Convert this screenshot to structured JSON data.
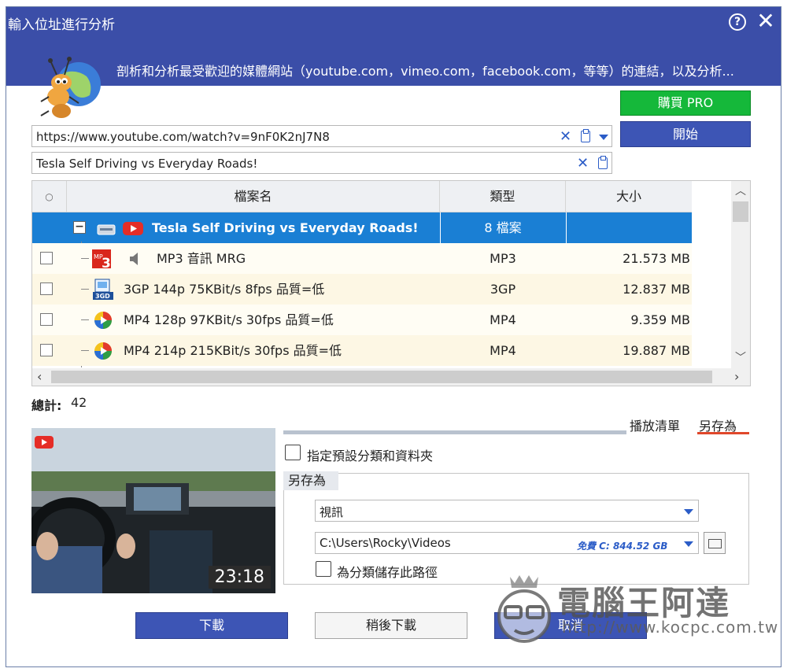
{
  "window": {
    "title": "輸入位址進行分析",
    "help_glyph": "?",
    "close_glyph": "✕",
    "description": "剖析和分析最受歡迎的媒體網站（youtube.com，vimeo.com，facebook.com，等等）的連結，以及分析..."
  },
  "buttons": {
    "buy_label": "購買 PRO",
    "start_label": "開始",
    "download_label": "下載",
    "download_later_label": "稍後下載",
    "cancel_label": "取消"
  },
  "url_field": {
    "value": "https://www.youtube.com/watch?v=9nF0K2nJ7N8"
  },
  "title_field": {
    "value": "Tesla Self Driving vs Everyday Roads!"
  },
  "table": {
    "columns": [
      "○",
      "檔案名",
      "類型",
      "大小"
    ],
    "parent": {
      "name": "Tesla Self Driving vs Everyday Roads!",
      "type": "8 檔案",
      "size": ""
    },
    "rows": [
      {
        "name": "MP3 音訊 MRG",
        "type": "MP3",
        "size": "21.573 MB"
      },
      {
        "name": "3GP 144p 75KBit/s 8fps 品質=低",
        "type": "3GP",
        "size": "12.837 MB"
      },
      {
        "name": "MP4 128p 97KBit/s 30fps 品質=低",
        "type": "MP4",
        "size": "9.359 MB"
      },
      {
        "name": "MP4 214p 215KBit/s 30fps 品質=低",
        "type": "MP4",
        "size": "19.887 MB"
      }
    ]
  },
  "total": {
    "label": "總計:",
    "value": "42"
  },
  "tabs": {
    "playlist": "播放清單",
    "save_as": "另存為"
  },
  "thumbnail": {
    "duration": "23:18"
  },
  "options": {
    "default_category": "指定預設分類和資料夾",
    "group_title": "另存為",
    "category_value": "視訊",
    "path_value": "C:\\Users\\Rocky\\Videos",
    "free_space": "免費 C: 844.52 GB",
    "save_path_for_category": "為分類儲存此路徑"
  },
  "watermark": {
    "text": "電腦王阿達",
    "url": "http://www.kocpc.com.tw"
  },
  "colors": {
    "titlebar": "#3b4ea8",
    "accent_blue": "#3d55b5",
    "buy_green": "#15b83a",
    "selected_row": "#1a7fd4",
    "tab_underline": "#e0472b"
  }
}
